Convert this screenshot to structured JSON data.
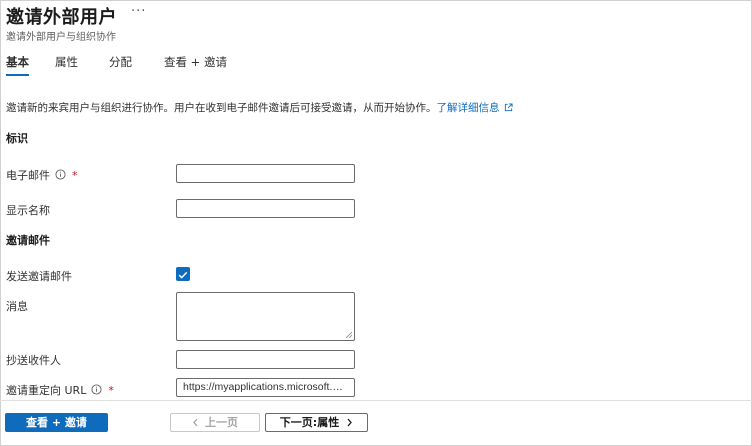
{
  "header": {
    "title": "邀请外部用户",
    "more": "···",
    "subtitle": "邀请外部用户与组织协作"
  },
  "tabs": [
    {
      "label": "基本",
      "active": true
    },
    {
      "label": "属性",
      "active": false
    },
    {
      "label": "分配",
      "active": false
    },
    {
      "label": "查看 + 邀请",
      "active": false
    }
  ],
  "intro": {
    "text": "邀请新的来宾用户与组织进行协作。用户在收到电子邮件邀请后可接受邀请，从而开始协作。",
    "link": "了解详细信息"
  },
  "identity": {
    "section_title": "标识",
    "email_label": "电子邮件",
    "email_value": "",
    "display_name_label": "显示名称",
    "display_name_value": ""
  },
  "invitation": {
    "section_title": "邀请邮件",
    "send_label": "发送邀请邮件",
    "send_checked": true,
    "message_label": "消息",
    "message_value": "",
    "cc_label": "抄送收件人",
    "cc_value": "",
    "redirect_label": "邀请重定向 URL",
    "redirect_value": "https://myapplications.microsoft.co..."
  },
  "required_mark": "*",
  "footer": {
    "review_button": "查看 + 邀请",
    "prev_button": "上一页",
    "next_button": "下一页:属性"
  },
  "colors": {
    "accent": "#0f6cbd",
    "required": "#c50f1f"
  }
}
